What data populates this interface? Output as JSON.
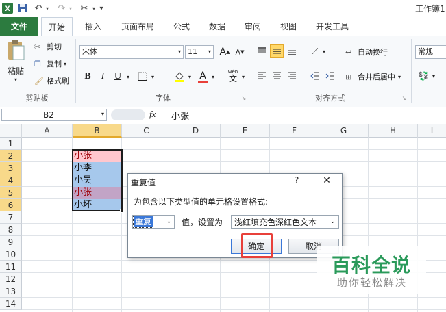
{
  "title_bar": {
    "window_title": "工作簿1",
    "customize_icon": "▾"
  },
  "tabs": [
    "文件",
    "开始",
    "插入",
    "页面布局",
    "公式",
    "数据",
    "审阅",
    "视图",
    "开发工具"
  ],
  "ribbon": {
    "clipboard": {
      "paste": "粘贴",
      "cut": "剪切",
      "copy": "复制",
      "format_painter": "格式刷",
      "label": "剪贴板"
    },
    "font": {
      "font_name": "宋体",
      "font_size": "11",
      "bold": "B",
      "italic": "I",
      "underline": "U",
      "grow": "A",
      "shrink": "A",
      "phonetic_top": "wén",
      "phonetic": "文",
      "label": "字体"
    },
    "alignment": {
      "wrap_text": "自动换行",
      "merge_center": "合并后居中",
      "label": "对齐方式"
    },
    "number": {
      "format": "常规"
    }
  },
  "formula_bar": {
    "name_box": "B2",
    "fx": "fx",
    "formula": "小张"
  },
  "grid": {
    "columns": [
      "A",
      "B",
      "C",
      "D",
      "E",
      "F",
      "G",
      "H",
      "I"
    ],
    "rows": [
      "1",
      "2",
      "3",
      "4",
      "5",
      "6",
      "7",
      "8",
      "9",
      "10",
      "11",
      "12",
      "13",
      "14"
    ],
    "cells_b": [
      {
        "row": "2",
        "value": "小张",
        "duplicate": true
      },
      {
        "row": "3",
        "value": "小李",
        "duplicate": false
      },
      {
        "row": "4",
        "value": "小吴",
        "duplicate": false
      },
      {
        "row": "5",
        "value": "小张",
        "duplicate": true
      },
      {
        "row": "6",
        "value": "小坏",
        "duplicate": false
      }
    ]
  },
  "dialog": {
    "title": "重复值",
    "help": "?",
    "close": "✕",
    "description": "为包含以下类型值的单元格设置格式:",
    "type_value": "重复",
    "value_label": "值，设置为",
    "format_value": "浅红填充色深红色文本",
    "ok": "确定",
    "cancel": "取消"
  },
  "watermark": {
    "title": "百科全说",
    "subtitle": "助你轻松解决"
  },
  "colors": {
    "excel_green": "#2c7b3f",
    "duplicate_fill": "#ffc7ce",
    "duplicate_text": "#9c0006",
    "selection": "#a6c8ec",
    "highlight_red": "#e8403a"
  }
}
